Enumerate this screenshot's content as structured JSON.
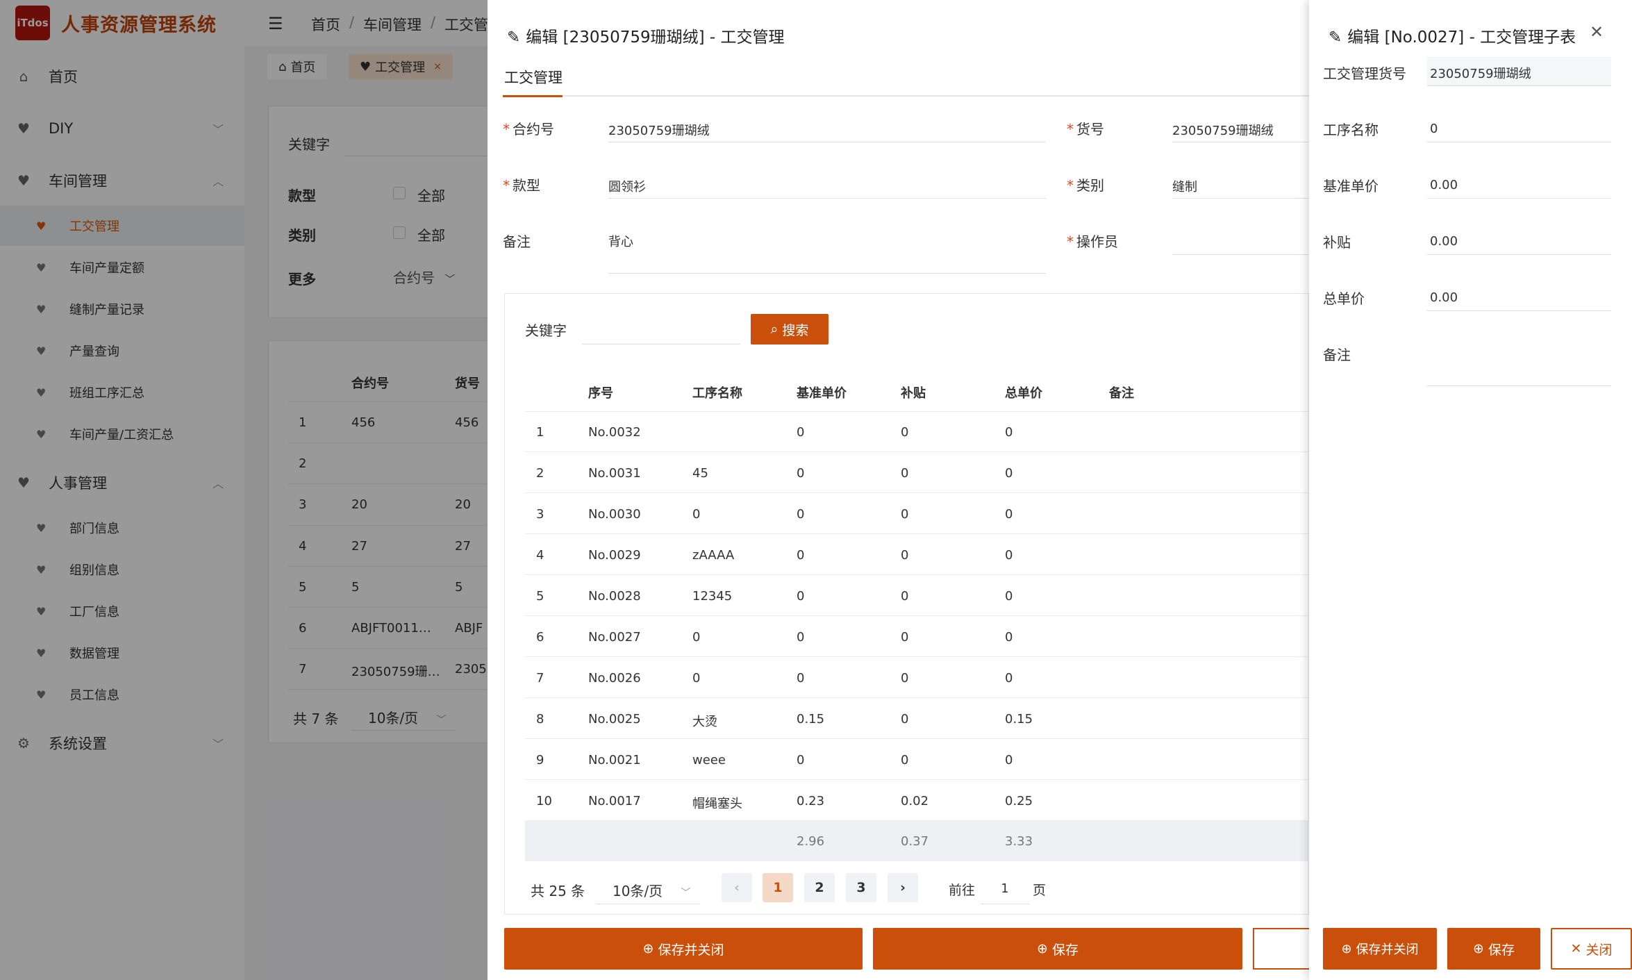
{
  "app": {
    "logo_text": "iTdos",
    "name": "人事资源管理系统"
  },
  "sidebar": {
    "items": [
      {
        "label": "首页",
        "icon": "home-icon"
      },
      {
        "label": "DIY",
        "icon": "heart-icon"
      },
      {
        "label": "车间管理",
        "icon": "heart-icon"
      },
      {
        "label": "人事管理",
        "icon": "heart-icon"
      },
      {
        "label": "系统设置",
        "icon": "gear-icon"
      }
    ],
    "workshop_sub": [
      "工交管理",
      "车间产量定额",
      "缝制产量记录",
      "产量查询",
      "班组工序汇总",
      "车间产量/工资汇总"
    ],
    "hr_sub": [
      "部门信息",
      "组别信息",
      "工厂信息",
      "数据管理",
      "员工信息"
    ]
  },
  "header": {
    "breadcrumb": [
      "首页",
      "车间管理",
      "工交管"
    ],
    "separator": "/",
    "tabs": [
      {
        "label": "首页"
      },
      {
        "label": "工交管理",
        "close": "×"
      }
    ]
  },
  "filter": {
    "keyword_label": "关键字",
    "style_label": "款型",
    "style_opt": "全部",
    "category_label": "类别",
    "category_opt": "全部",
    "more_label": "更多",
    "more_select": "合约号"
  },
  "bg_table": {
    "headers": [
      "合约号",
      "货号"
    ],
    "rows": [
      [
        "1",
        "456",
        "456"
      ],
      [
        "2",
        "",
        ""
      ],
      [
        "3",
        "20",
        "20"
      ],
      [
        "4",
        "27",
        "27"
      ],
      [
        "5",
        "5",
        "5"
      ],
      [
        "6",
        "ABJFT0011…",
        "ABJF"
      ],
      [
        "7",
        "23050759珊…",
        "23050"
      ]
    ],
    "total": "共 7 条",
    "page_size": "10条/页"
  },
  "drawer1": {
    "title": "编辑 [23050759珊瑚绒] - 工交管理",
    "tab": "工交管理",
    "fields": {
      "contract_label": "合约号",
      "contract_value": "23050759珊瑚绒",
      "item_label": "货号",
      "item_value": "23050759珊瑚绒",
      "style_label": "款型",
      "style_value": "圆领衫",
      "category_label": "类别",
      "category_value": "缝制",
      "note_label": "备注",
      "note_value": "背心",
      "operator_label": "操作员",
      "operator_value": ""
    },
    "search": {
      "label": "关键字",
      "button": "搜索"
    },
    "table": {
      "headers": [
        "序号",
        "工序名称",
        "基准单价",
        "补贴",
        "总单价",
        "备注"
      ],
      "rows": [
        [
          "1",
          "No.0032",
          "",
          "0",
          "0",
          "0"
        ],
        [
          "2",
          "No.0031",
          "45",
          "0",
          "0",
          "0"
        ],
        [
          "3",
          "No.0030",
          "0",
          "0",
          "0",
          "0"
        ],
        [
          "4",
          "No.0029",
          "zAAAA",
          "0",
          "0",
          "0"
        ],
        [
          "5",
          "No.0028",
          "12345",
          "0",
          "0",
          "0"
        ],
        [
          "6",
          "No.0027",
          "0",
          "0",
          "0",
          "0"
        ],
        [
          "7",
          "No.0026",
          "0",
          "0",
          "0",
          "0"
        ],
        [
          "8",
          "No.0025",
          "大烫",
          "0.15",
          "0",
          "0.15"
        ],
        [
          "9",
          "No.0021",
          "weee",
          "0",
          "0",
          "0"
        ],
        [
          "10",
          "No.0017",
          "帽绳塞头",
          "0.23",
          "0.02",
          "0.25"
        ]
      ],
      "summary": [
        "2.96",
        "0.37",
        "3.33"
      ]
    },
    "pagination": {
      "total": "共 25 条",
      "page_size": "10条/页",
      "pages": [
        "1",
        "2",
        "3"
      ],
      "goto_label": "前往",
      "goto_value": "1",
      "page_unit": "页",
      "prev": "‹",
      "next": "›"
    },
    "buttons": {
      "save_close": "保存并关闭",
      "save": "保存"
    }
  },
  "drawer2": {
    "title": "编辑 [No.0027] - 工交管理子表",
    "close": "✕",
    "fields": [
      {
        "label": "工交管理货号",
        "value": "23050759珊瑚绒"
      },
      {
        "label": "工序名称",
        "value": "0"
      },
      {
        "label": "基准单价",
        "value": "0.00"
      },
      {
        "label": "补贴",
        "value": "0.00"
      },
      {
        "label": "总单价",
        "value": "0.00"
      },
      {
        "label": "备注",
        "value": ""
      }
    ],
    "buttons": {
      "save_close": "保存并关闭",
      "save": "保存",
      "close": "关闭"
    }
  },
  "colors": {
    "accent": "#c94f0a",
    "brand": "#b5160e"
  }
}
